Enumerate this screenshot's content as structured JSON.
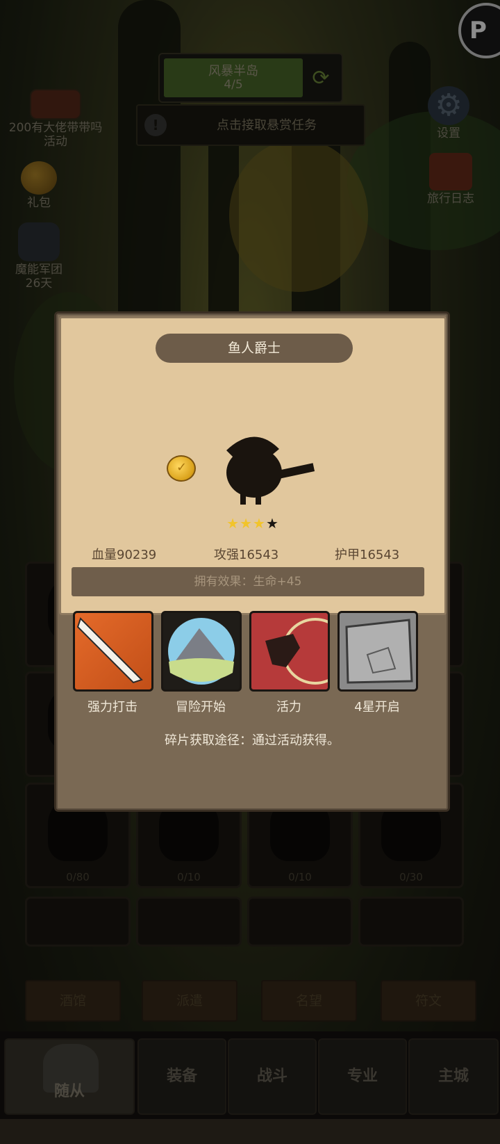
{
  "hud": {
    "stage_name": "风暴半岛",
    "stage_progress": "4/5",
    "bounty_text": "点击接取悬赏任务"
  },
  "left_menu": [
    {
      "label": "200有大佬带带吗\n活动",
      "icon": "event-board-icon"
    },
    {
      "label": "礼包",
      "icon": "gift-coin-icon"
    },
    {
      "label": "魔能军团\n26天",
      "icon": "legion-crest-icon"
    }
  ],
  "right_menu": [
    {
      "label": "设置",
      "icon": "gear-icon"
    },
    {
      "label": "旅行日志",
      "icon": "journal-icon"
    }
  ],
  "grid_counts": [
    "0/80",
    "0/10",
    "0/10",
    "0/30"
  ],
  "tabs": [
    "酒馆",
    "派遣",
    "名望",
    "符文"
  ],
  "bottom_nav": [
    "随从",
    "装备",
    "战斗",
    "专业",
    "主城"
  ],
  "hero": {
    "name": "鱼人爵士",
    "stars_filled": 3,
    "stars_total": 4,
    "hp": "血量90239",
    "attack": "攻强16543",
    "armor": "护甲16543",
    "effect": "拥有效果：生命+45"
  },
  "skills": [
    {
      "label": "强力打击",
      "icon": "sword-strike-icon"
    },
    {
      "label": "冒险开始",
      "icon": "mountain-icon"
    },
    {
      "label": "活力",
      "icon": "dash-warrior-icon"
    },
    {
      "label": "4星开启",
      "icon": "locked-stone-icon"
    }
  ],
  "shard_source": "碎片获取途径：通过活动获得。",
  "colors": {
    "card_bg": "#e1c79d",
    "modal_bg": "#7a6954",
    "star_gold": "#f2c42a"
  }
}
